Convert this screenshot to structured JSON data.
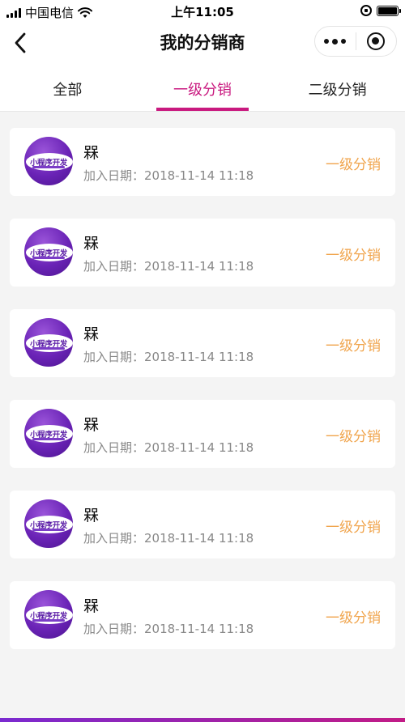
{
  "status_bar": {
    "carrier": "中国电信",
    "time": "上午11:05"
  },
  "navbar": {
    "title": "我的分销商"
  },
  "tabs": [
    {
      "label": "全部",
      "active": false
    },
    {
      "label": "一级分销",
      "active": true
    },
    {
      "label": "二级分销",
      "active": false
    }
  ],
  "distributors": [
    {
      "name": "槑",
      "avatar_text": "小程序开发",
      "date_label": "加入日期：2018-11-14 11:18",
      "level": "一级分销"
    },
    {
      "name": "槑",
      "avatar_text": "小程序开发",
      "date_label": "加入日期：2018-11-14 11:18",
      "level": "一级分销"
    },
    {
      "name": "槑",
      "avatar_text": "小程序开发",
      "date_label": "加入日期：2018-11-14 11:18",
      "level": "一级分销"
    },
    {
      "name": "槑",
      "avatar_text": "小程序开发",
      "date_label": "加入日期：2018-11-14 11:18",
      "level": "一级分销"
    },
    {
      "name": "槑",
      "avatar_text": "小程序开发",
      "date_label": "加入日期：2018-11-14 11:18",
      "level": "一级分销"
    },
    {
      "name": "槑",
      "avatar_text": "小程序开发",
      "date_label": "加入日期：2018-11-14 11:18",
      "level": "一级分销"
    }
  ],
  "colors": {
    "accent": "#c9197f",
    "level_tag": "#f0a44c",
    "avatar_purple": "#6a23b6"
  },
  "icons": {
    "back": "chevron-left-icon",
    "more": "more-dots-icon",
    "close": "target-icon",
    "wifi": "wifi-icon",
    "signal": "signal-icon",
    "battery": "battery-icon",
    "rotation_lock": "rotation-lock-icon"
  }
}
